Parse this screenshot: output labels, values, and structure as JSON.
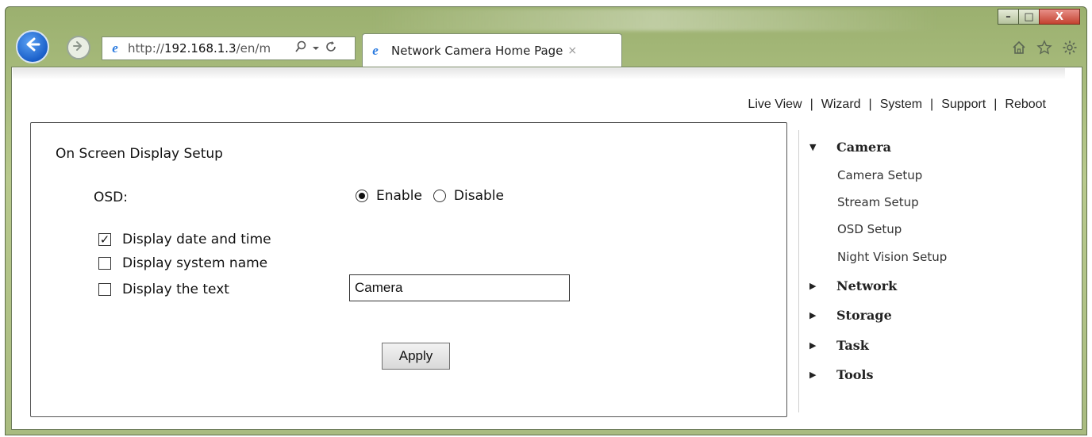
{
  "window": {
    "buttons": {
      "minimize": "–",
      "maximize": "□",
      "close": "X"
    }
  },
  "browser": {
    "address_url_prefix": "http://",
    "address_url_host": "192.168.1.3",
    "address_url_rest": "/en/m",
    "tab_title": "Network Camera Home Page",
    "tab_close": "×",
    "icons": [
      "back-icon",
      "forward-icon",
      "ie-icon",
      "search-icon",
      "refresh-icon",
      "home-icon",
      "favorites-star-icon",
      "settings-gear-icon"
    ]
  },
  "topnav": {
    "items": [
      "Live View",
      "Wizard",
      "System",
      "Support",
      "Reboot"
    ],
    "separator": "|"
  },
  "form": {
    "title": "On Screen Display Setup",
    "osd_label": "OSD:",
    "osd_enable_label": "Enable",
    "osd_disable_label": "Disable",
    "osd_selected": "Enable",
    "checkboxes": [
      {
        "label": "Display date and time",
        "checked": true
      },
      {
        "label": "Display system name",
        "checked": false
      },
      {
        "label": "Display the text",
        "checked": false
      }
    ],
    "text_value": "Camera",
    "apply_label": "Apply"
  },
  "sidebar": {
    "sections": [
      {
        "label": "Camera",
        "expanded": true,
        "items": [
          "Camera Setup",
          "Stream Setup",
          "OSD Setup",
          "Night Vision Setup"
        ]
      },
      {
        "label": "Network",
        "expanded": false
      },
      {
        "label": "Storage",
        "expanded": false
      },
      {
        "label": "Task",
        "expanded": false
      },
      {
        "label": "Tools",
        "expanded": false
      }
    ]
  }
}
